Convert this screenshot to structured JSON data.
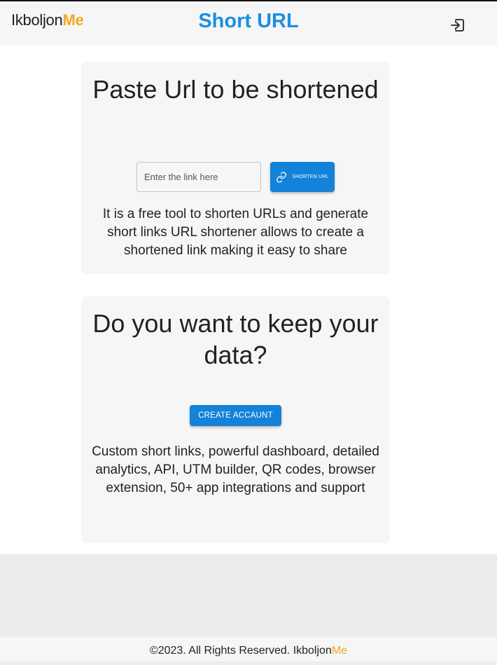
{
  "header": {
    "brand_name": "Ikboljon",
    "brand_suffix": "Me",
    "title": "Short URL",
    "login_icon": "login-icon"
  },
  "shorten_card": {
    "heading": "Paste Url to be shortened",
    "input_placeholder": "Enter the link here",
    "input_value": "",
    "button_label": "SHORTEN URL",
    "button_icon": "link-icon",
    "description": "It is a free tool to shorten URLs and generate short links URL shortener allows to create a shortened link making it easy to share"
  },
  "account_card": {
    "heading": "Do you want to keep your data?",
    "button_label": "CREATE ACCAUNT",
    "description": "Custom short links, powerful dashboard, detailed analytics, API, UTM builder, QR codes, browser extension, 50+ app integrations and support"
  },
  "footer": {
    "text": "©2023. All Rights Reserved. Ikboljon",
    "brand_suffix": "Me"
  },
  "colors": {
    "accent": "#1482d8",
    "title_blue": "#1a8fe3",
    "brand_orange": "#f5a623"
  }
}
